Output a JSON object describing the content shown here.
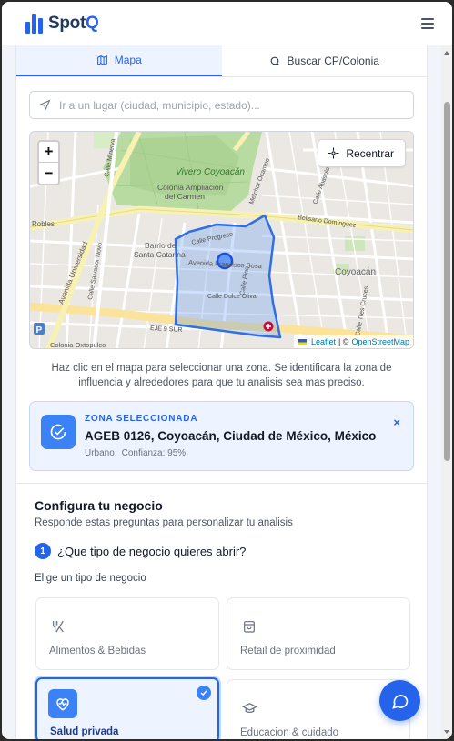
{
  "app": {
    "brand_prefix": "Spot",
    "brand_suffix": "Q",
    "accent_color": "#2563eb"
  },
  "tabs": [
    {
      "label": "Mapa",
      "icon": "map-icon",
      "active": true
    },
    {
      "label": "Buscar CP/Colonia",
      "icon": "search-icon",
      "active": false
    }
  ],
  "search": {
    "placeholder": "Ir a un lugar (ciudad, municipio, estado)...",
    "value": ""
  },
  "map": {
    "recenter_label": "Recentrar",
    "zoom_in": "+",
    "zoom_out": "−",
    "attribution": {
      "leaflet": "Leaflet",
      "separator": "| ©",
      "osm": "OpenStreetMap"
    },
    "labels": {
      "vivero": "Vivero Coyoacán",
      "colonia_ampliacion_1": "Colonia Ampliación",
      "colonia_ampliacion_2": "del Carmen",
      "barrio_1": "Barrio de",
      "barrio_2": "Santa Catarina",
      "avenida_francisco": "Avenida Francisco Sosa",
      "avenida_universidad": "Avenida Universidad",
      "coyoacan": "Coyoacán",
      "eje": "EJE 9 SUR",
      "colonia_oxtopulco": "Colonia Oxtopulco",
      "belisario": "Belisario Domínguez",
      "calle_dulce_oliva": "Calle Dulce Oliva",
      "calle_progreso": "Calle Progreso",
      "calle_pino": "Calle Pino",
      "calle_minerva": "Calle Minerva",
      "calle_salvador_novo": "Calle Salvador Novo",
      "melchor_ocampo": "Melchor Ocampo",
      "tres_cruces": "Calle Tres Cruces",
      "robles": "Robles",
      "abasolo": "Calle Abasolo"
    }
  },
  "map_hint": "Haz clic en el mapa para seleccionar una zona. Se identificara la zona de influencia y alrededores para que tu analisis sea mas preciso.",
  "zone": {
    "label": "ZONA SELECCIONADA",
    "title": "AGEB 0126, Coyoacán, Ciudad de México, México",
    "type": "Urbano",
    "confidence": "Confianza: 95%",
    "close": "×"
  },
  "config": {
    "title": "Configura tu negocio",
    "subtitle": "Responde estas preguntas para personalizar tu analisis",
    "question_number": "1",
    "question": "¿Que tipo de negocio quieres abrir?",
    "hint": "Elige un tipo de negocio",
    "options": [
      {
        "label": "Alimentos & Bebidas",
        "icon": "utensils-icon",
        "selected": false
      },
      {
        "label": "Retail de proximidad",
        "icon": "shopping-bag-icon",
        "selected": false
      },
      {
        "label": "Salud privada",
        "icon": "heart-pulse-icon",
        "selected": true
      },
      {
        "label": "Educacion & cuidado",
        "icon": "graduation-cap-icon",
        "selected": false
      }
    ]
  }
}
